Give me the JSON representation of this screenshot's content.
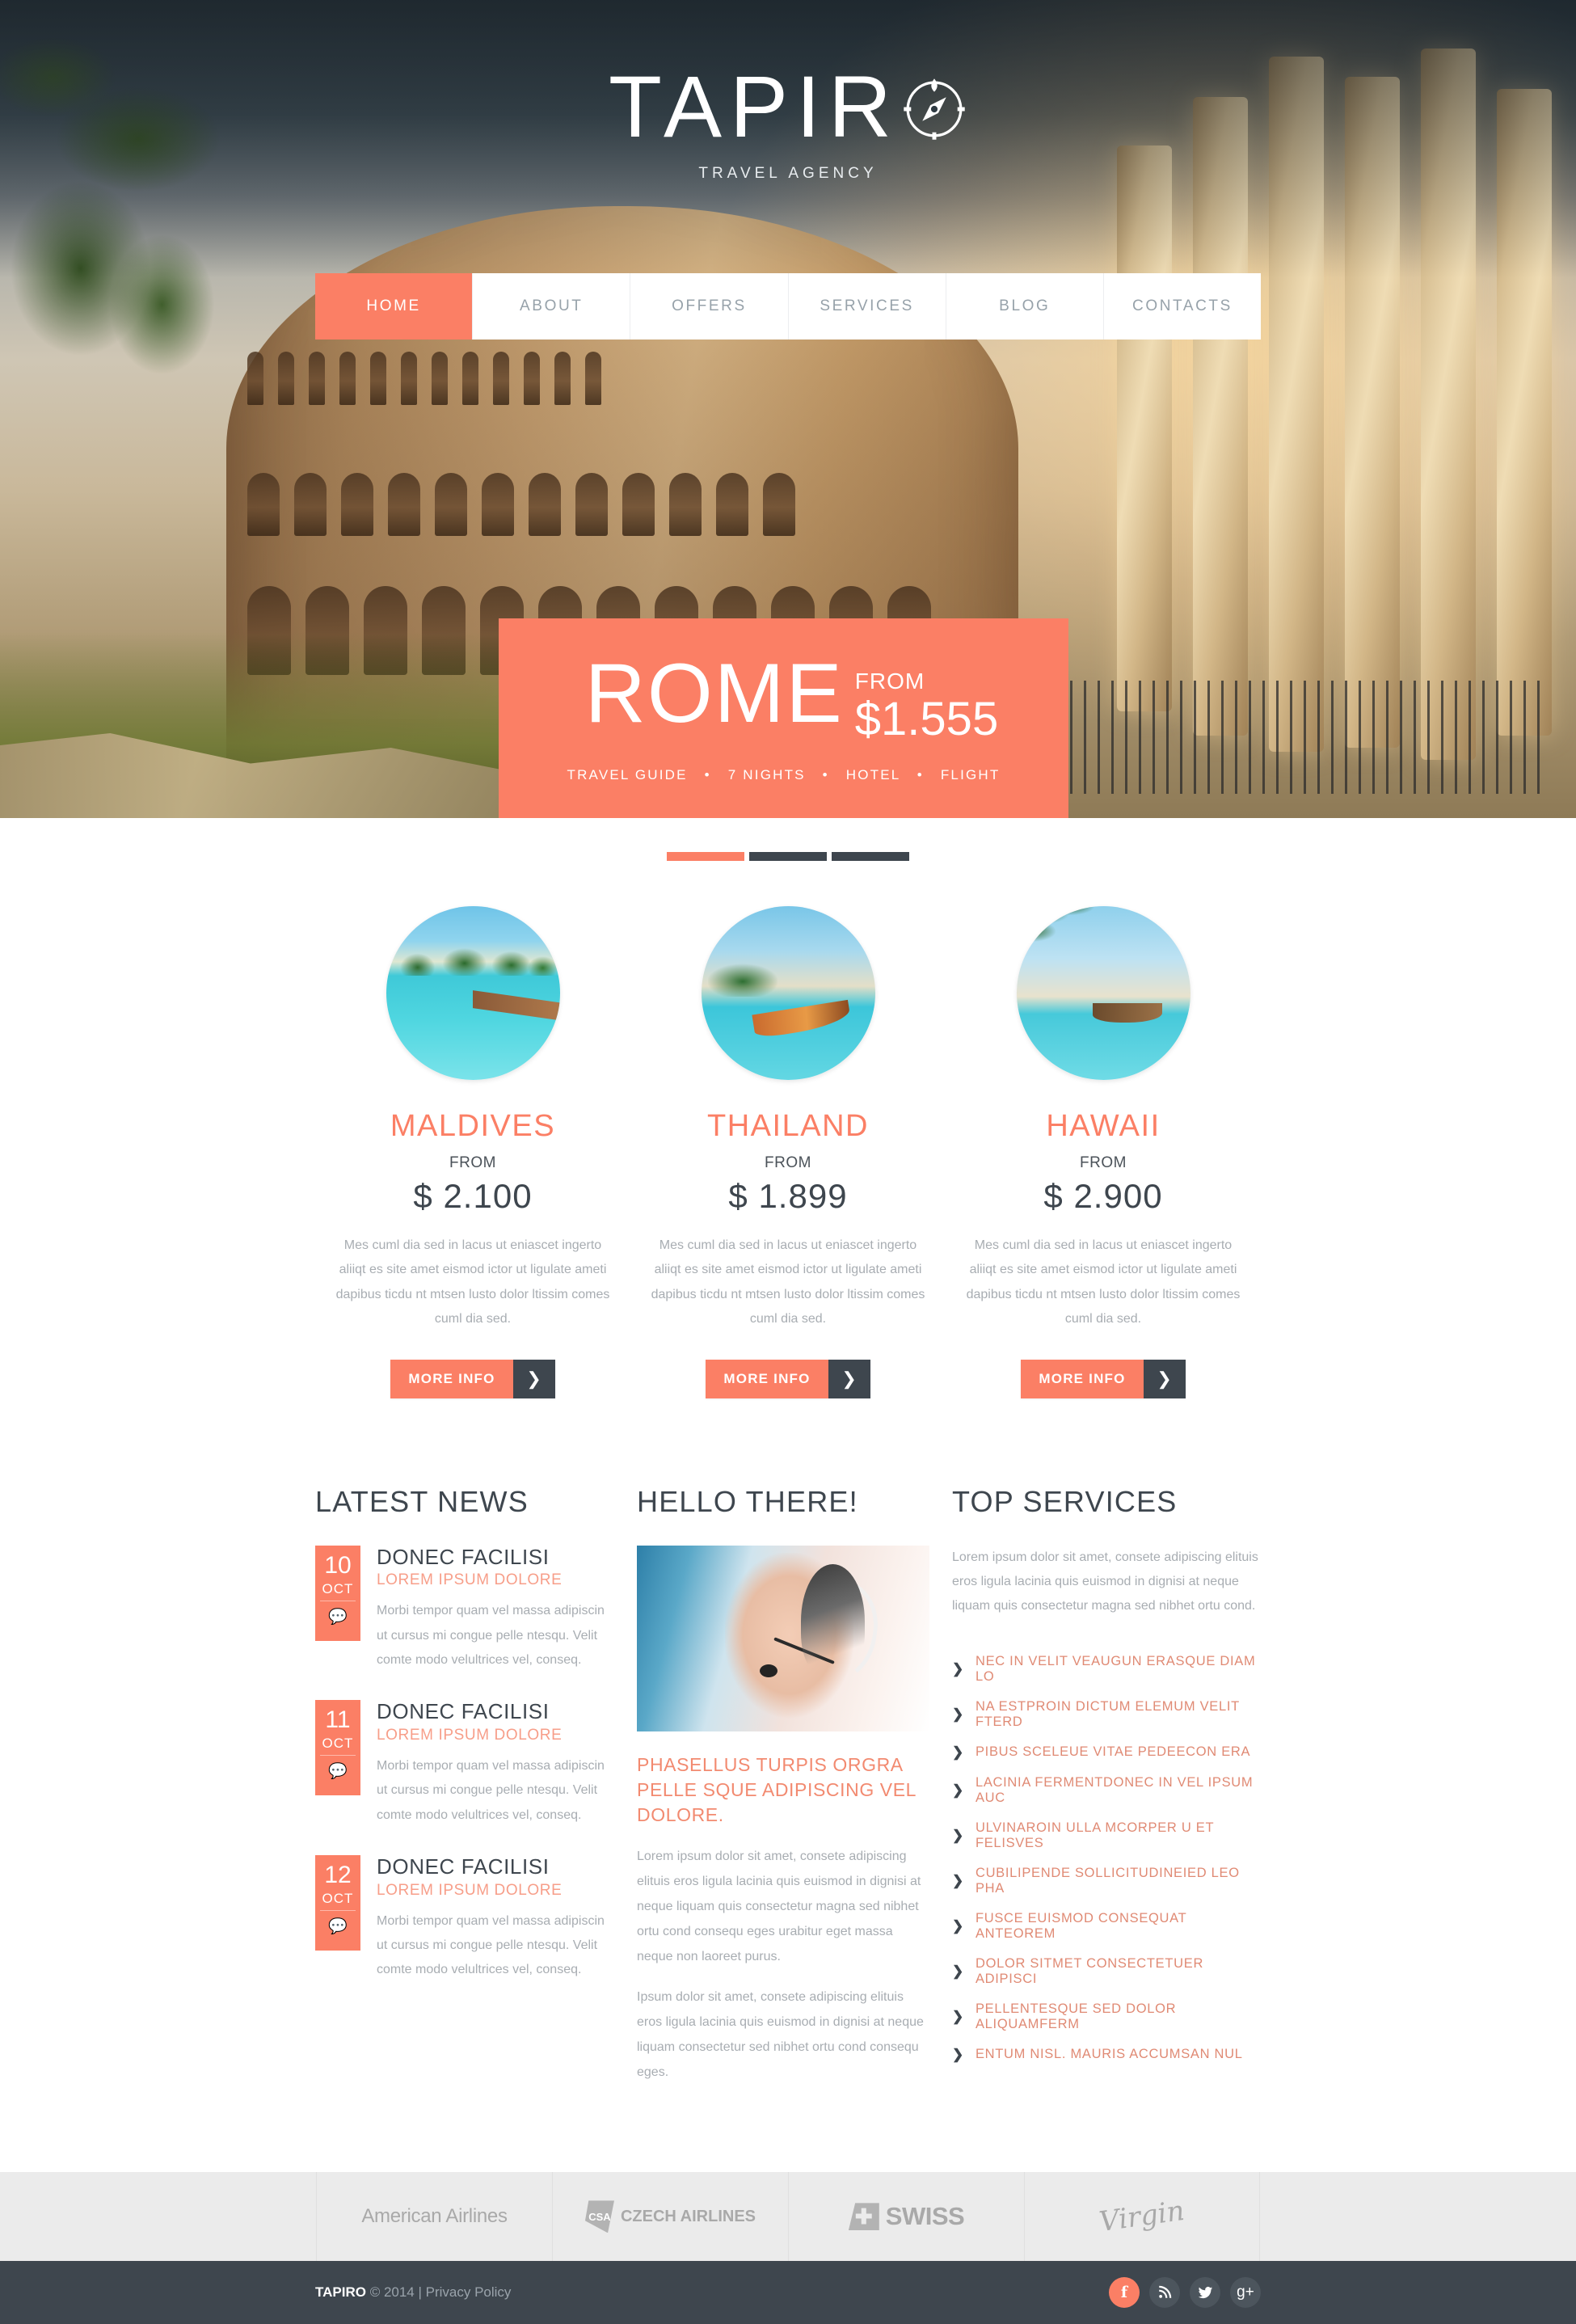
{
  "brand": {
    "logo_text": "TAPIR",
    "logo_icon": "compass-icon",
    "logo_tagline": "TRAVEL AGENCY"
  },
  "nav": {
    "items": [
      {
        "label": "HOME",
        "active": true
      },
      {
        "label": "ABOUT",
        "active": false
      },
      {
        "label": "OFFERS",
        "active": false
      },
      {
        "label": "SERVICES",
        "active": false
      },
      {
        "label": "BLOG",
        "active": false
      },
      {
        "label": "CONTACTS",
        "active": false
      }
    ]
  },
  "hero": {
    "promo": {
      "city": "ROME",
      "from_label": "FROM",
      "price": "$1.555",
      "features": [
        "TRAVEL GUIDE",
        "7 NIGHTS",
        "HOTEL",
        "FLIGHT"
      ],
      "separator": "•"
    },
    "slides": [
      {
        "active": true
      },
      {
        "active": false
      },
      {
        "active": false
      }
    ]
  },
  "destinations": [
    {
      "name": "MALDIVES",
      "from_label": "FROM",
      "price": "$ 2.100",
      "description": "Mes cuml dia sed in lacus ut eniascet ingerto aliiqt es site amet eismod ictor ut ligulate ameti dapibus ticdu nt mtsen lusto dolor ltissim comes cuml dia sed.",
      "button_label": "MORE INFO",
      "button_arrow": "❯",
      "image_alt": "maldives-overwater-huts-photo"
    },
    {
      "name": "THAILAND",
      "from_label": "FROM",
      "price": "$ 1.899",
      "description": "Mes cuml dia sed in lacus ut eniascet ingerto aliiqt es site amet eismod ictor ut ligulate ameti dapibus ticdu nt mtsen lusto dolor ltissim comes cuml dia sed.",
      "button_label": "MORE INFO",
      "button_arrow": "❯",
      "image_alt": "thailand-longtail-boat-photo"
    },
    {
      "name": "HAWAII",
      "from_label": "FROM",
      "price": "$ 2.900",
      "description": "Mes cuml dia sed in lacus ut eniascet ingerto aliiqt es site amet eismod ictor ut ligulate ameti dapibus ticdu nt mtsen lusto dolor ltissim comes cuml dia sed.",
      "button_label": "MORE INFO",
      "button_arrow": "❯",
      "image_alt": "hawaii-palm-beach-photo"
    }
  ],
  "news": {
    "title": "LATEST NEWS",
    "items": [
      {
        "day": "10",
        "month": "OCT",
        "title": "DONEC FACILISI",
        "subtitle": "LOREM IPSUM DOLORE",
        "text": "Morbi tempor quam vel massa adipiscin ut cursus mi congue pelle ntesqu. Velit comte modo velultrices vel, conseq.",
        "comment_icon": "comment-bubble-icon"
      },
      {
        "day": "11",
        "month": "OCT",
        "title": "DONEC FACILISI",
        "subtitle": "LOREM IPSUM DOLORE",
        "text": "Morbi tempor quam vel massa adipiscin ut cursus mi congue pelle ntesqu. Velit comte modo velultrices vel, conseq.",
        "comment_icon": "comment-bubble-icon"
      },
      {
        "day": "12",
        "month": "OCT",
        "title": "DONEC FACILISI",
        "subtitle": "LOREM IPSUM DOLORE",
        "text": "Morbi tempor quam vel massa adipiscin ut cursus mi congue pelle ntesqu. Velit comte modo velultrices vel, conseq.",
        "comment_icon": "comment-bubble-icon"
      }
    ]
  },
  "hello": {
    "title": "HELLO THERE!",
    "image_alt": "call-center-operator-headset-photo",
    "heading": "PHASELLUS TURPIS ORGRA PELLE SQUE ADIPISCING VEL DOLORE.",
    "paragraph1": "Lorem ipsum dolor sit amet, consete adipiscing elituis eros ligula lacinia quis euismod in dignisi at neque liquam quis consectetur magna sed nibhet ortu cond consequ eges urabitur eget massa neque non laoreet purus.",
    "paragraph2": "Ipsum dolor sit amet, consete adipiscing elituis eros ligula lacinia quis euismod in dignisi at neque liquam consectetur sed nibhet ortu cond consequ eges."
  },
  "services": {
    "title": "TOP SERVICES",
    "intro": "Lorem ipsum dolor sit amet, consete adipiscing elituis eros ligula lacinia quis euismod in dignisi at neque liquam quis consectetur magna sed nibhet ortu cond.",
    "chevron": "❯",
    "items": [
      "NEC IN VELIT VEAUGUN ERASQUE DIAM LO",
      "NA ESTPROIN DICTUM ELEMUM VELIT FTERD",
      "PIBUS SCELEUE VITAE PEDEECON ERA",
      "LACINIA FERMENTDONEC IN VEL IPSUM AUC",
      "ULVINAROIN ULLA MCORPER U ET FELISVES",
      "CUBILIPENDE SOLLICITUDINEIED LEO PHA",
      "FUSCE EUISMOD CONSEQUAT ANTEOREM",
      "DOLOR SITMET CONSECTETUER ADIPISCI",
      "PELLENTESQUE SED DOLOR  ALIQUAMFERM",
      "ENTUM NISL. MAURIS ACCUMSAN NUL"
    ]
  },
  "partners": [
    {
      "name": "American Airlines",
      "logo_type": "american-airlines-logo"
    },
    {
      "name": "CZECH AIRLINES",
      "mark": "CSA",
      "logo_type": "czech-airlines-logo"
    },
    {
      "name": "SWISS",
      "mark": "✚",
      "logo_type": "swiss-logo"
    },
    {
      "name": "Virgin",
      "logo_type": "virgin-logo"
    }
  ],
  "footer": {
    "brand": "TAPIRO",
    "copyright": " © 2014 | ",
    "privacy_label": "Privacy Policy",
    "socials": [
      {
        "name": "facebook",
        "glyph": "f",
        "active": true
      },
      {
        "name": "rss",
        "glyph": "◝",
        "active": false
      },
      {
        "name": "twitter",
        "glyph": "🐦",
        "active": false
      },
      {
        "name": "google-plus",
        "glyph": "g+",
        "active": false
      }
    ]
  },
  "colors": {
    "accent": "#fb7f65",
    "dark": "#3e464e",
    "muted": "#a8adb2",
    "partner_bg": "#ebebeb"
  }
}
